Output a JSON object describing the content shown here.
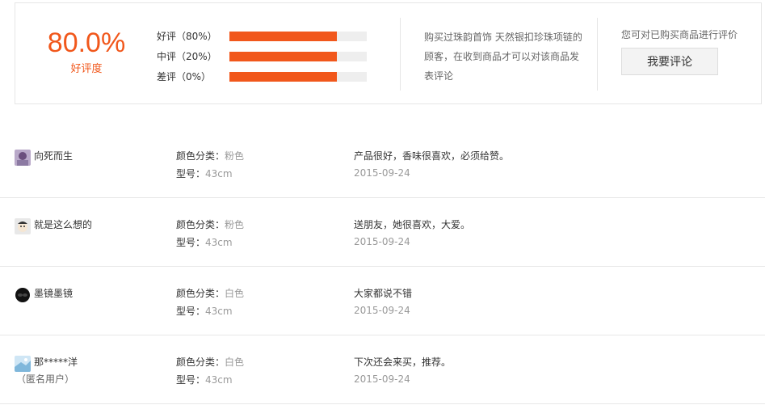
{
  "summary": {
    "rate": "80.0%",
    "rate_label": "好评度",
    "bars": [
      {
        "label": "好评（80%）",
        "fill": 0.78
      },
      {
        "label": "中评（20%）",
        "fill": 0.78
      },
      {
        "label": "差评（0%）",
        "fill": 0.78
      }
    ],
    "info_text": "购买过珠韵首饰 天然银扣珍珠项链的顾客，在收到商品才可以对该商品发表评论",
    "cta_text": "您可对已购买商品进行评价",
    "cta_button": "我要评论"
  },
  "colors": {
    "accent": "#f1571b"
  },
  "reviews": [
    {
      "user": "向死而生",
      "anon": "",
      "color_label": "颜色分类：",
      "color_value": "粉色",
      "model_label": "型号：",
      "model_value": "43cm",
      "content": "产品很好，香味很喜欢，必须给赞。",
      "date": "2015-09-24",
      "avatar_icon": "avatar-icon-purple"
    },
    {
      "user": "就是这么想的",
      "anon": "",
      "color_label": "颜色分类：",
      "color_value": "粉色",
      "model_label": "型号：",
      "model_value": "43cm",
      "content": "送朋友，她很喜欢，大爱。",
      "date": "2015-09-24",
      "avatar_icon": "avatar-icon-cartoon"
    },
    {
      "user": "墨镜墨镜",
      "anon": "",
      "color_label": "颜色分类：",
      "color_value": "白色",
      "model_label": "型号：",
      "model_value": "43cm",
      "content": "大家都说不错",
      "date": "2015-09-24",
      "avatar_icon": "avatar-icon-dark"
    },
    {
      "user": "那*****洋",
      "anon": "（匿名用户）",
      "color_label": "颜色分类：",
      "color_value": "白色",
      "model_label": "型号：",
      "model_value": "43cm",
      "content": "下次还会来买，推荐。",
      "date": "2015-09-24",
      "avatar_icon": "avatar-icon-blue"
    }
  ]
}
